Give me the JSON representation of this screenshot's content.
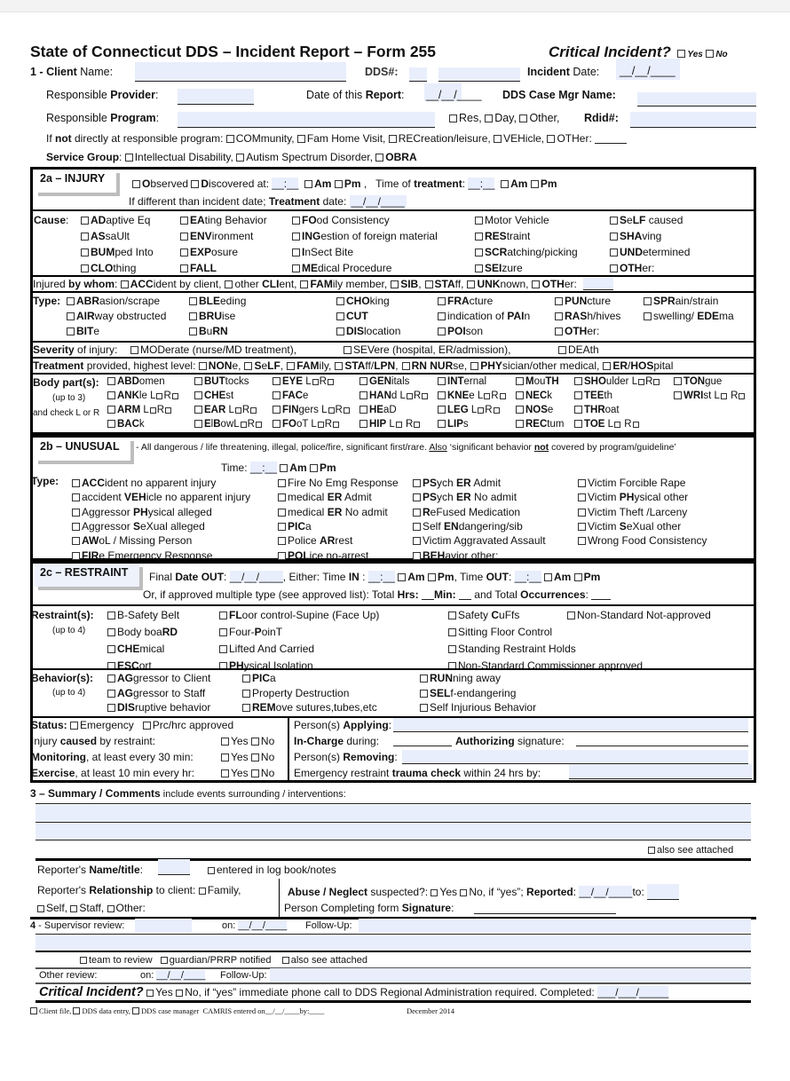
{
  "header": {
    "title": "State of Connecticut DDS – Incident Report – Form 255",
    "critical_label": "Critical Incident?",
    "yes": "Yes",
    "no": "No"
  },
  "section1": {
    "client_prefix": "1 - ",
    "client_bold": "Client",
    "client_rest": " Name:",
    "dds_num": "DDS#:",
    "incident_bold": "Incident",
    "incident_rest": " Date:",
    "date_blank": "__/__/____",
    "resp_provider_pre": "Responsible ",
    "resp_provider_bold": "Provider",
    "date_report_pre": "Date of this ",
    "date_report_bold": "Report",
    "case_mgr": "DDS Case Mgr Name:",
    "resp_program_pre": "Responsible ",
    "resp_program_bold": "Program",
    "res": "Res,",
    "day": "Day,",
    "other": "Other,",
    "rdid": "Rdid#:",
    "notat_pre": "If ",
    "notat_bold": "not",
    "notat_rest": " directly at responsible program:",
    "locations": [
      "COMmunity,",
      "Fam Home Visit,",
      "RECreation/leisure,",
      "VEHicle,",
      "OTHer:"
    ],
    "service_group_label": "Service Group",
    "service_groups": [
      "Intellectual Disability,",
      "Autism Spectrum Disorder,",
      "OBRA"
    ]
  },
  "injury": {
    "header": "2a – INJURY",
    "observed": "Observed",
    "discovered": "Discovered at:",
    "time_blank": "__:__",
    "am": "Am",
    "pm": "Pm",
    "time_treatment_pre": "Time of ",
    "time_treatment_bold": "treatment",
    "diff_date_pre": "If different than incident date; ",
    "diff_date_bold": "Treatment",
    "diff_date_rest": " date:",
    "cause_label": "Cause",
    "causes": [
      [
        "ADaptive Eq",
        "EAting Behavior",
        "FOod Consistency",
        "Motor Vehicle",
        "SeLF caused"
      ],
      [
        "ASsaUlt",
        "ENVironment",
        "INGestion of foreign material",
        "REStraint",
        "SHAving"
      ],
      [
        "BUMped Into",
        "EXPosure",
        "InSect Bite",
        "SCRatching/picking",
        "UNDetermined"
      ],
      [
        "CLOthing",
        "FALL",
        "MEdical Procedure",
        "SEIzure",
        "OTHer:"
      ]
    ],
    "by_whom_pre": "Injured ",
    "by_whom_bold": "by whom",
    "by_whom": [
      "ACCident by client,",
      "other CLIent,",
      "FAMily member,",
      "SIB,",
      "STAff,",
      "UNKnown,",
      "OTHer:"
    ],
    "type_label": "Type:",
    "types": [
      [
        "ABRasion/scrape",
        "BLEeding",
        "CHOking",
        "FRActure",
        "PUNcture",
        "SPRain/strain"
      ],
      [
        "AIRway obstructed",
        "BRUise",
        "CUT",
        "indication of PAIn",
        "RASh/hives",
        "swelling/ EDEma"
      ],
      [
        "BITe",
        "BuRN",
        "DISlocation",
        "POIson",
        "OTHer:",
        ""
      ]
    ],
    "severity_bold": "Severity",
    "severity_rest": " of injury:",
    "severity": [
      "MODerate (nurse/MD treatment),",
      "SEVere (hospital, ER/admission),",
      "DEAth"
    ],
    "treatment_bold": "Treatment",
    "treatment_rest": " provided, highest level:",
    "treatments": [
      "NONe,",
      "SeLF,",
      "FAMily,",
      "STAff/LPN,",
      "RN NURse,",
      "PHYsician/other medical,",
      "ER/HOSpital"
    ],
    "body_label": "Body part(s):",
    "body_sub1": "(up to 3)",
    "body_sub2": "and check L or R",
    "body_parts": [
      [
        "ABDomen",
        "BUTtocks",
        "EYE L□R□",
        "GENitals",
        "INTernal",
        "MouTH",
        "SHOulder L□R□",
        "TONgue"
      ],
      [
        "ANKle L□R□",
        "CHEst",
        "FACe",
        "HANd L□R□",
        "KNEe L□R□",
        "NECk",
        "TEEth",
        "WRIst L□ R□"
      ],
      [
        "ARM L□R□",
        "EAR L□R□",
        "FINgers L□R□",
        "HEaD",
        "LEG L□R□",
        "NOSe",
        "THRoat",
        ""
      ],
      [
        "BACk",
        "ElBowL□R□",
        "FOoT L□R□",
        "HIP L□ R□",
        "LIPs",
        "RECtum",
        "TOE L□ R□",
        ""
      ]
    ]
  },
  "unusual": {
    "header": "2b – UNUSUAL",
    "desc_pre": " - All dangerous / life threatening, illegal, police/fire, significant first/rare. ",
    "desc_also": "Also",
    "desc_mid": " ‘significant behavior ",
    "desc_not": "not",
    "desc_end": " covered by program/guideline’",
    "time_label": "Time:",
    "type_label": "Type:",
    "types": [
      [
        "ACCident no apparent injury",
        "Fire No Emg Response",
        "PSych ER Admit",
        "Victim Forcible Rape"
      ],
      [
        "accident VEHicle no apparent injury",
        "medical ER Admit",
        "PSych ER No admit",
        "Victim PHysical other"
      ],
      [
        "Aggressor PHysical alleged",
        "medical ER No admit",
        "ReFused  Medication",
        "Victim Theft /Larceny"
      ],
      [
        "Aggressor SeXual alleged",
        "PICa",
        "Self ENdangering/sib",
        "Victim SeXual other"
      ],
      [
        "AWoL / Missing Person",
        "Police ARrest",
        "Victim Aggravated Assault",
        "Wrong Food Consistency"
      ],
      [
        "FIRe Emergency Response",
        "POLice no-arrest",
        "BEHavior other:",
        ""
      ]
    ]
  },
  "restraint": {
    "header": "2c – RESTRAINT",
    "final_date": "Final Date OUT:",
    "either": ", Either: Time IN :",
    "time_out": "Time OUT:",
    "or_line_pre": "Or,  if approved multiple type (see approved list):  Total ",
    "hrs": "Hrs:",
    "min": "Min:",
    "occ_pre": "and Total ",
    "occ": "Occurrences",
    "restraints_label": "Restraint(s):",
    "up_to_4": "(up to 4)",
    "restraints": [
      [
        "B-Safety Belt",
        "FLoor control-Supine (Face Up)",
        "Safety CuFfs",
        "Non-Standard Not-approved"
      ],
      [
        "Body boaRD",
        "Four-PoinT",
        "Sitting Floor Control",
        ""
      ],
      [
        "CHEmical",
        "Lifted And Carried",
        "Standing Restraint Holds",
        ""
      ],
      [
        "ESCort",
        "PHysical Isolation",
        "Non-Standard Commissioner approved",
        ""
      ]
    ],
    "behaviors_label": "Behavior(s):",
    "behaviors": [
      [
        "AGgressor to Client",
        "PICa",
        "RUNning away"
      ],
      [
        "AGgressor to Staff",
        "Property Destruction",
        "SELf-endangering"
      ],
      [
        "DISruptive behavior",
        "REMove sutures,tubes,etc",
        "Self Injurious Behavior"
      ]
    ],
    "status_label": "Status:",
    "status_opts": [
      "Emergency",
      "Prc/hrc approved"
    ],
    "injury_caused_pre": "Injury ",
    "injury_caused_bold": "caused",
    "injury_caused_rest": " by restraint:",
    "monitoring_bold": "Monitoring",
    "monitoring_rest": ", at least every 30 min:",
    "exercise_bold": "Exercise",
    "exercise_rest": ", at least 10 min every hr:",
    "yes": "Yes",
    "no": "No",
    "applying_pre": "Person(s) ",
    "applying_bold": "Applying",
    "incharge_bold": "In-Charge",
    "incharge_rest": " during:",
    "authorizing_bold": "Authorizing",
    "authorizing_rest": " signature:",
    "removing_pre": "Person(s) ",
    "removing_bold": "Removing",
    "trauma_pre": "Emergency restraint ",
    "trauma_bold": "trauma check",
    "trauma_rest": " within 24 hrs by:"
  },
  "summary": {
    "title_pre": "3 – ",
    "title_bold": "Summary / Comments",
    "title_rest": " include events surrounding / interventions:",
    "also_attached": "also see attached",
    "reporter_pre": "Reporter's ",
    "reporter_bold": "Name/title",
    "log_book": "entered in log book/notes",
    "relationship_pre": "Reporter's ",
    "relationship_bold": "Relationship",
    "relationship_rest": " to client:",
    "rel_opts": [
      "Family,",
      "Self,",
      "Staff,",
      "Other:"
    ],
    "abuse_bold": "Abuse / Neglect",
    "abuse_rest": " suspected?:",
    "abuse_no_rest": "No, if  “yes”; ",
    "reported": "Reported",
    "to": "to:",
    "signature_pre": "Person Completing form ",
    "signature_bold": "Signature"
  },
  "supervisor": {
    "label_num": "4",
    "label_rest": " - Supervisor review:",
    "on": "on:",
    "follow_up": "Follow-Up:",
    "checks": [
      "team to review",
      "guardian/PRRP notified",
      "also see attached"
    ],
    "other_review": "Other review:",
    "critical_label": "Critical Incident?",
    "critical_rest": "No, if “yes” immediate phone call to DDS Regional Administration required. Completed:"
  },
  "footer": {
    "checks": [
      "Client file,",
      "DDS data entry,",
      "DDS case manager"
    ],
    "camris": "CAMRIS entered on",
    "by": "by:",
    "date": "December 2014"
  }
}
